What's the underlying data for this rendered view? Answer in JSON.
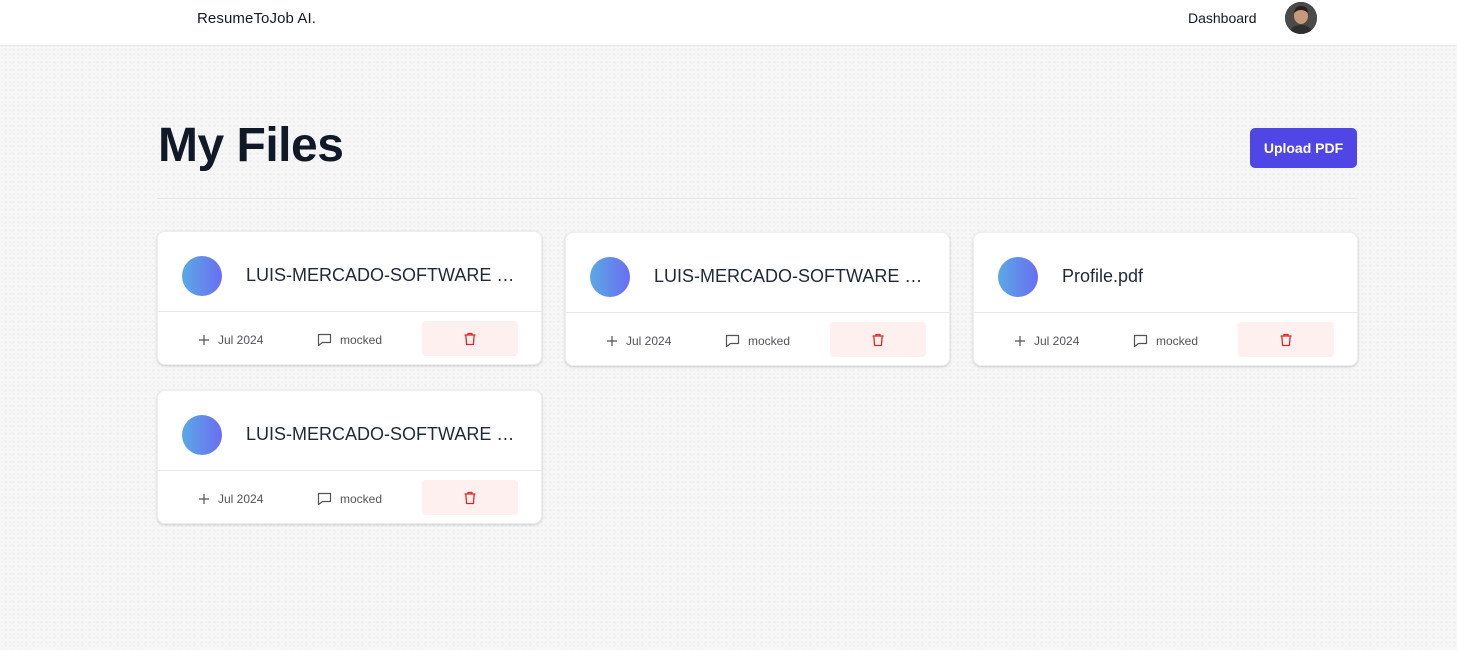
{
  "navbar": {
    "brand": "ResumeToJob AI.",
    "dashboard_link": "Dashboard",
    "avatar_icon": "user-avatar"
  },
  "header": {
    "title": "My Files",
    "upload_button": "Upload PDF"
  },
  "colors": {
    "primary": "#4f46e5",
    "delete_bg": "#fdf0ee",
    "delete_icon": "#dc2626",
    "gradient_start": "#5aa9e6",
    "gradient_end": "#6b6ef0"
  },
  "files": [
    {
      "name": "LUIS-MERCADO-SOFTWARE E...",
      "date": "Jul 2024",
      "status": "mocked",
      "icons": [
        "plus-icon",
        "message-icon",
        "trash-icon"
      ]
    },
    {
      "name": "LUIS-MERCADO-SOFTWARE E...",
      "date": "Jul 2024",
      "status": "mocked",
      "icons": [
        "plus-icon",
        "message-icon",
        "trash-icon"
      ]
    },
    {
      "name": "Profile.pdf",
      "date": "Jul 2024",
      "status": "mocked",
      "icons": [
        "plus-icon",
        "message-icon",
        "trash-icon"
      ]
    },
    {
      "name": "LUIS-MERCADO-SOFTWARE E...",
      "date": "Jul 2024",
      "status": "mocked",
      "icons": [
        "plus-icon",
        "message-icon",
        "trash-icon"
      ]
    }
  ]
}
